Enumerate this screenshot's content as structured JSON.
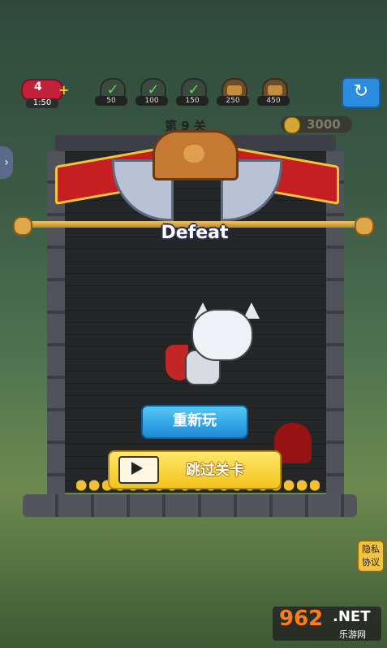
{
  "hud": {
    "lives": "4",
    "timer": "1:50",
    "stages": [
      {
        "label": "50",
        "type": "check"
      },
      {
        "label": "100",
        "type": "check"
      },
      {
        "label": "150",
        "type": "check"
      },
      {
        "label": "250",
        "type": "chest"
      },
      {
        "label": "450",
        "type": "chest"
      }
    ],
    "refresh_icon": "↻",
    "level": "第 9 关",
    "coins": "3000"
  },
  "result": {
    "title": "Defeat"
  },
  "buttons": {
    "retry": "重新玩",
    "skip": "跳过关卡"
  },
  "side": {
    "privacy": [
      "隐私",
      "协议"
    ],
    "expand_icon": "›"
  },
  "watermark": {
    "logo": "962",
    "sub": "乐游网",
    "net": ".NET"
  },
  "colors": {
    "retry_button": "#1c8ad8",
    "skip_button": "#f2c41b",
    "ribbon": "#c51f22"
  }
}
